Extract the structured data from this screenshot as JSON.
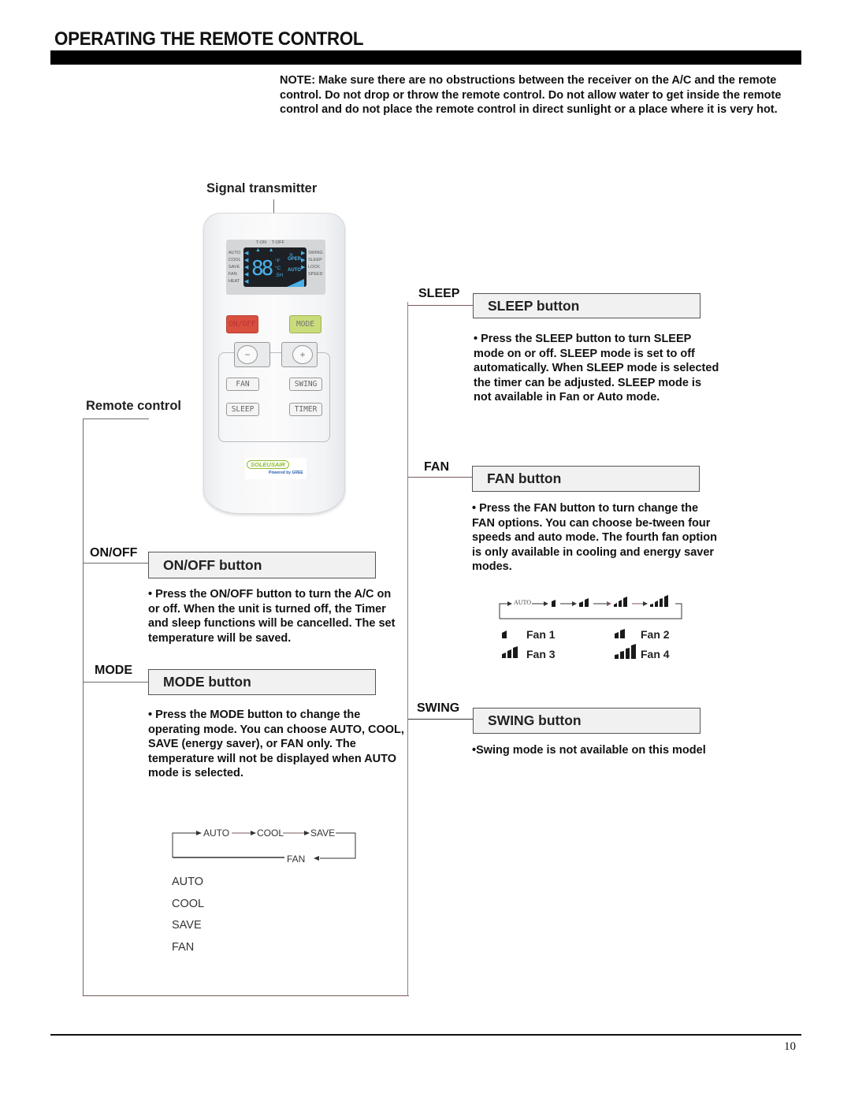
{
  "page": {
    "title": "OPERATING THE REMOTE CONTROL",
    "note": "NOTE: Make sure there are no obstructions between the receiver on the A/C and the remote control. Do not drop or throw the remote control. Do not allow water to get inside the remote control and do not place the remote control in direct sunlight or a place where it is very hot.",
    "page_number": "10"
  },
  "figure": {
    "signal_transmitter_label": "Signal transmitter",
    "remote_control_label": "Remote control",
    "remote": {
      "lcd": {
        "timer_labels": [
          "T-ON",
          "T-OFF"
        ],
        "left_modes": [
          "AUTO",
          "COOL",
          "SAVE",
          "FAN",
          "HEAT"
        ],
        "right_labels": [
          "SWING",
          "SLEEP",
          "LOCK",
          "SPEED"
        ],
        "digits": "88",
        "units": [
          "°F",
          "°C",
          ".5H"
        ],
        "oper": "OPER",
        "auto": "AUTO"
      },
      "buttons": {
        "onoff": "ON/OFF",
        "mode": "MODE",
        "minus": "−",
        "plus": "+",
        "fan": "FAN",
        "swing": "SWING",
        "sleep": "SLEEP",
        "timer": "TIMER"
      },
      "logo_brand": "SOLEUSAIR",
      "logo_sub": "Powered by GREE"
    }
  },
  "sections": {
    "onoff": {
      "label": "ON/OFF",
      "title": "ON/OFF button",
      "description": "• Press the ON/OFF button to turn the A/C on or off. When the unit is turned off, the Timer and sleep functions will be cancelled. The set temperature will be saved."
    },
    "mode": {
      "label": "MODE",
      "title": "MODE button",
      "description": "• Press the MODE button to change the operating mode. You can choose AUTO, COOL, SAVE (energy saver), or FAN only. The temperature will not be displayed when AUTO mode is selected.",
      "flow": [
        "AUTO",
        "COOL",
        "SAVE",
        "FAN"
      ],
      "list": [
        "AUTO",
        "COOL",
        "SAVE",
        "FAN"
      ]
    },
    "sleep": {
      "label": "SLEEP",
      "title": "SLEEP button",
      "description": "• Press the SLEEP button to turn SLEEP mode on or off. SLEEP mode is set to off automatically. When SLEEP mode is selected the timer can be adjusted. SLEEP mode is not available in Fan or Auto mode."
    },
    "fan": {
      "label": "FAN",
      "title": "FAN button",
      "description": "• Press the FAN button to turn change the FAN options. You can choose be-tween four speeds and auto mode. The fourth fan option is only available in cooling and energy saver modes.",
      "flow_start": "AUTO",
      "speeds": [
        "Fan 1",
        "Fan 2",
        "Fan 3",
        "Fan 4"
      ]
    },
    "swing": {
      "label": "SWING",
      "title": "SWING button",
      "description": "•Swing mode is not available on this model"
    }
  }
}
